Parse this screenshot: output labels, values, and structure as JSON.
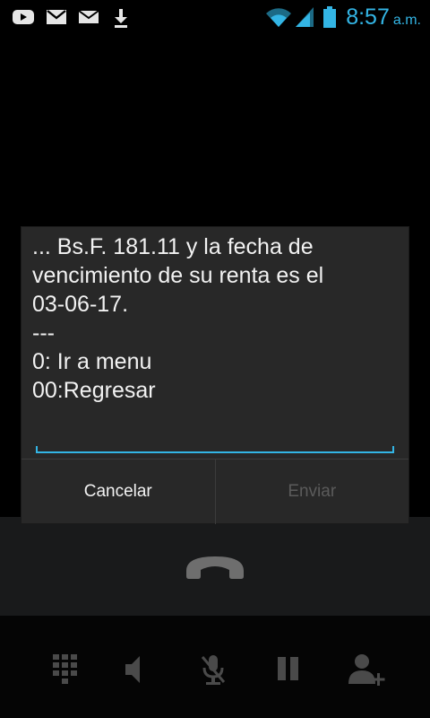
{
  "status_bar": {
    "icons": [
      "youtube-icon",
      "gmail-icon",
      "email-icon",
      "download-icon",
      "wifi-icon",
      "signal-icon",
      "battery-icon"
    ],
    "time": "8:57",
    "time_suffix": "a.m."
  },
  "dialog": {
    "message": "... Bs.F. 181.11 y la fecha de\nvencimiento de su renta es el\n03-06-17.\n---\n0: Ir a menu\n00:Regresar",
    "input_value": "",
    "cancel_label": "Cancelar",
    "send_label": "Enviar"
  },
  "call_controls": {
    "icons": [
      "dialpad-icon",
      "speaker-icon",
      "mute-mic-icon",
      "hold-icon",
      "add-call-icon",
      "end-call-icon"
    ]
  },
  "colors": {
    "accent": "#33b5e5",
    "dialog_bg": "#282828",
    "disabled_text": "#5b5b5b"
  }
}
